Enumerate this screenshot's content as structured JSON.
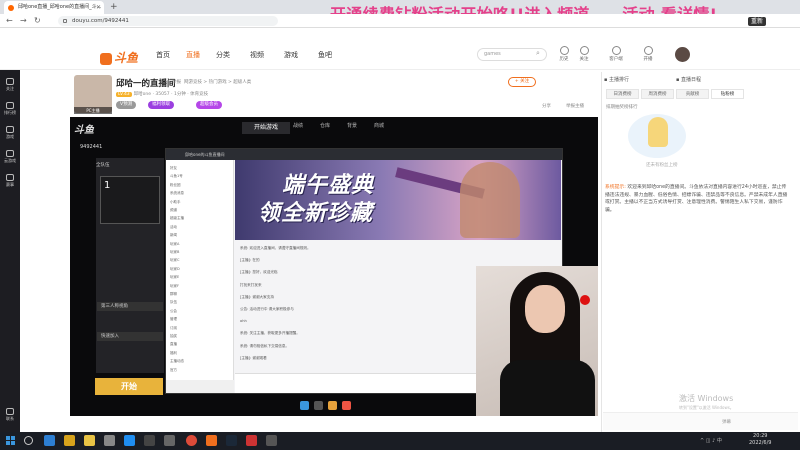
{
  "browser": {
    "tab_title": "邱哈one直播_邱哈one的直播间_斗...",
    "url": "douyu.com/9492441",
    "banner": "开通续费钻粉活动开始咯!!进入频道——活动 看详情!",
    "restart_label": "重新"
  },
  "site": {
    "logo": "斗鱼",
    "nav": [
      "首页",
      "直播",
      "分类",
      "视频",
      "游戏",
      "鱼吧"
    ],
    "search_placeholder": "games",
    "tools": [
      "历史",
      "关注",
      "客户端",
      "开播"
    ]
  },
  "left_rail": [
    "关注",
    "排行榜",
    "游戏",
    "云游戏",
    "赛事",
    "联系"
  ],
  "room": {
    "title": "邱哈一的直播间",
    "tag": "举报",
    "category": "网游竞技 > 热门游戏 > 超级人类",
    "level": "LV.43",
    "host_name": "邱哈one",
    "fans": "35057",
    "badge_stat": "1分钟",
    "location": "体育竞技",
    "avatar_label": "PC主播",
    "follow_label": "+ 关注",
    "pills": [
      "V预测",
      "福利领取",
      "超级会员"
    ],
    "actions": [
      "分享",
      "举报主播"
    ]
  },
  "game": {
    "badge": "斗鱼",
    "room_id": "9492441",
    "tabs": [
      "战绩",
      "仓库",
      "背景",
      "商城"
    ],
    "start_label": "开始游戏",
    "team_label": "全队伍",
    "slot_number": "1",
    "mode1": "第三人称视角",
    "mode2": "快速加入",
    "big_start": "开始"
  },
  "chat_window": {
    "title": "邱哈one的斗鱼直播间",
    "contacts": [
      "好友",
      "斗鱼1号",
      "粉丝团",
      "系统消息",
      "小助手",
      "频道",
      "超级主播",
      "活动",
      "新闻",
      "玩家A",
      "玩家B",
      "玩家C",
      "玩家D",
      "玩家E",
      "玩家F",
      "群聊",
      "队伍",
      "公会",
      "管理",
      "订阅",
      "抽奖",
      "直播",
      "福利",
      "主播动态",
      "官方"
    ],
    "ad_line1": "端午盛典",
    "ad_line2": "领全新珍藏",
    "messages": [
      "系统: 欢迎进入直播间，请遵守直播间规则。",
      "[主播]: 在的",
      "[主播]: 您好，欢迎光临",
      "打扰来打扰来",
      "[主播]: 谢谢大家支持",
      "公告: 活动进行中 请大家积极参与",
      "ohh",
      "系统: 关注主播，获取更多开播提醒。",
      "系统: 请勿相信私下交易信息。",
      "[主播]: 谢谢观看"
    ]
  },
  "right_panel": {
    "rank_title": "主播排行",
    "host_title": "直播日程",
    "rank_tabs": [
      "日消费榜",
      "周消费榜",
      "贡献榜",
      "钻粉榜"
    ],
    "rank_sub": "排期抽奖榜排行",
    "empty_text": "还未有粉丝上榜",
    "sys_tip": "系统提示:",
    "sys_msg": "欢迎来到邱哈one的直播间。斗鱼依法对直播内容进行24小时巡查，禁止传播违法违规、暴力血腥、低俗色情、招嫖诈骗、违禁品等不良信息。严禁未成年人直播或打赏。主播以不正当方式诱导打赏、注意理性消费。警惕陌生人私下交易，谨防诈骗。",
    "input_label": "弹幕"
  },
  "os": {
    "activation": "激活 Windows",
    "activation_sub": "转到\"设置\"以激活 Windows。",
    "time": "20:29",
    "date": "2022/6/9"
  }
}
